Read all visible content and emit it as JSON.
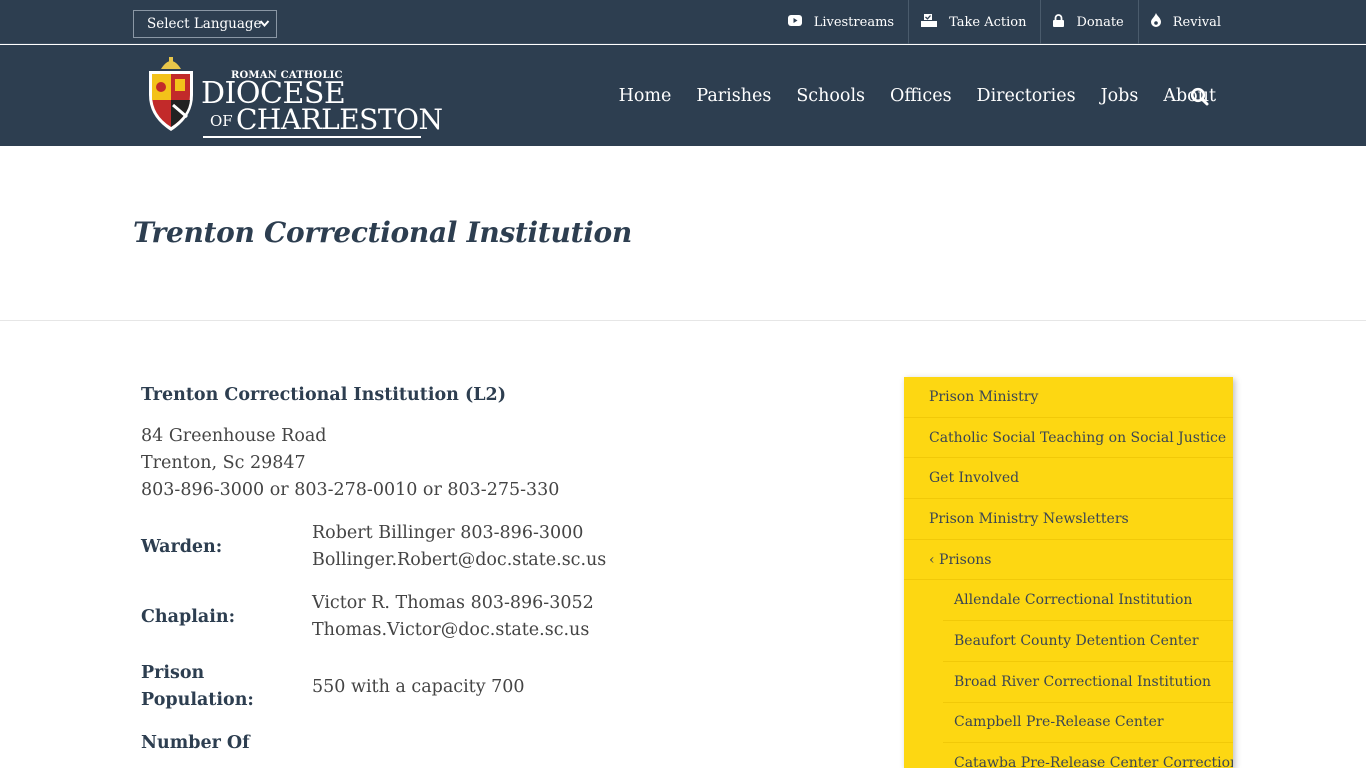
{
  "topbar": {
    "language_select": "Select Language",
    "links": [
      {
        "label": "Livestreams",
        "icon": "youtube-icon"
      },
      {
        "label": "Take Action",
        "icon": "ballot-box-icon"
      },
      {
        "label": "Donate",
        "icon": "lock-icon"
      },
      {
        "label": "Revival",
        "icon": "flame-icon"
      }
    ]
  },
  "header": {
    "logo": {
      "roman": "ROMAN CATHOLIC",
      "diocese": "DIOCESE",
      "of": "OF",
      "charleston": "CHARLESTON"
    },
    "nav": [
      "Home",
      "Parishes",
      "Schools",
      "Offices",
      "Directories",
      "Jobs",
      "About"
    ]
  },
  "page": {
    "title": "Trenton Correctional Institution"
  },
  "content": {
    "heading": "Trenton Correctional Institution (L2)",
    "address": [
      "84 Greenhouse Road",
      "Trenton, Sc 29847",
      "803-896-3000 or 803-278-0010 or 803-275-330"
    ],
    "rows": [
      {
        "label": "Warden:",
        "values": [
          "Robert Billinger 803-896-3000",
          "Bollinger.Robert@doc.state.sc.us"
        ]
      },
      {
        "label": "Chaplain:",
        "values": [
          "Victor R. Thomas 803-896-3052",
          "Thomas.Victor@doc.state.sc.us"
        ]
      },
      {
        "label": "Prison Population:",
        "values": [
          "550 with a capacity 700"
        ]
      },
      {
        "label": "Number Of",
        "values": []
      }
    ]
  },
  "sidebar": {
    "items": [
      "Prison Ministry",
      "Catholic Social Teaching on Social Justice",
      "Get Involved",
      "Prison Ministry Newsletters",
      "‹ Prisons"
    ],
    "subitems": [
      "Allendale Correctional Institution",
      "Beaufort County Detention Center",
      "Broad River Correctional Institution",
      "Campbell Pre-Release Center",
      "Catawba Pre-Release Center Correctional"
    ]
  },
  "colors": {
    "navy": "#2d3e50",
    "sidebar_yellow": "#fdd712"
  }
}
